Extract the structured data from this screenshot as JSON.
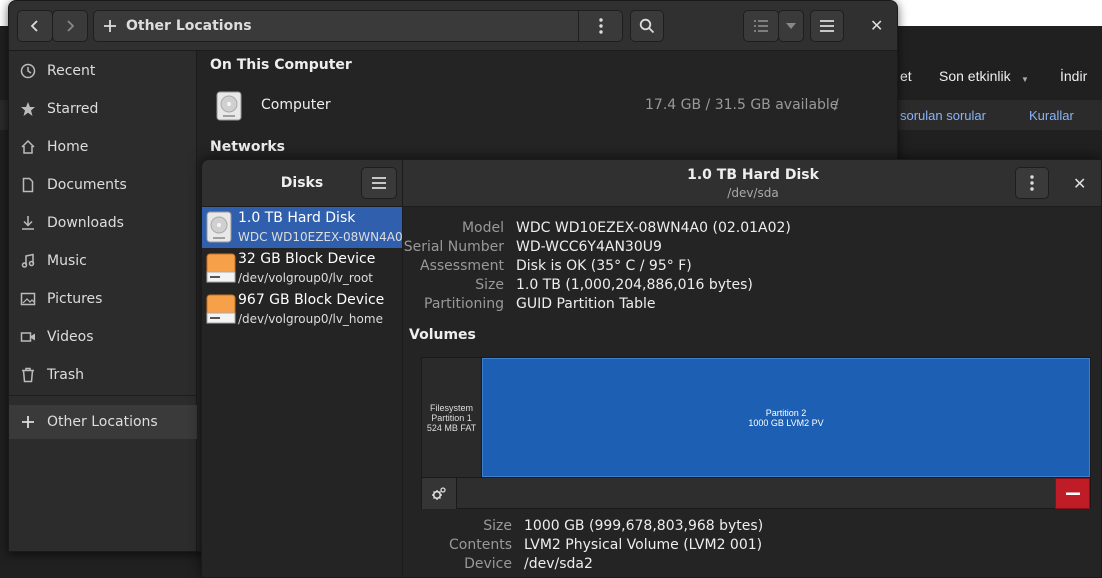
{
  "background_page": {
    "nav": [
      "et",
      "Son etkinlik",
      "İndir"
    ],
    "subnav": [
      "sorulan sorular",
      "Kurallar"
    ]
  },
  "files": {
    "path": "Other Locations",
    "sidebar": [
      {
        "label": "Recent",
        "icon": "clock-icon"
      },
      {
        "label": "Starred",
        "icon": "star-icon"
      },
      {
        "label": "Home",
        "icon": "home-icon"
      },
      {
        "label": "Documents",
        "icon": "document-icon"
      },
      {
        "label": "Downloads",
        "icon": "download-icon"
      },
      {
        "label": "Music",
        "icon": "music-icon"
      },
      {
        "label": "Pictures",
        "icon": "picture-icon"
      },
      {
        "label": "Videos",
        "icon": "video-icon"
      },
      {
        "label": "Trash",
        "icon": "trash-icon"
      },
      {
        "label": "Other Locations",
        "icon": "plus-icon"
      }
    ],
    "on_this_computer": "On This Computer",
    "computer": {
      "name": "Computer",
      "available": "17.4 GB / 31.5 GB available",
      "mount": "/"
    },
    "networks": "Networks"
  },
  "disks": {
    "title": "Disks",
    "drive_title": "1.0 TB Hard Disk",
    "drive_subtitle": "/dev/sda",
    "list": [
      {
        "name": "1.0 TB Hard Disk",
        "sub": "WDC WD10EZEX-08WN4A0",
        "selected": true
      },
      {
        "name": "32 GB Block Device",
        "sub": "/dev/volgroup0/lv_root",
        "selected": false
      },
      {
        "name": "967 GB Block Device",
        "sub": "/dev/volgroup0/lv_home",
        "selected": false
      }
    ],
    "drive_info": [
      {
        "key": "Model",
        "value": "WDC WD10EZEX-08WN4A0 (02.01A02)"
      },
      {
        "key": "Serial Number",
        "value": "WD-WCC6Y4AN30U9"
      },
      {
        "key": "Assessment",
        "value": "Disk is OK (35° C / 95° F)"
      },
      {
        "key": "Size",
        "value": "1.0 TB (1,000,204,886,016 bytes)"
      },
      {
        "key": "Partitioning",
        "value": "GUID Partition Table"
      }
    ],
    "volumes_label": "Volumes",
    "partitions": [
      {
        "line1": "Filesystem",
        "line2": "Partition 1",
        "line3": "524 MB FAT"
      },
      {
        "line1": "Partition 2",
        "line2": "1000 GB LVM2 PV"
      }
    ],
    "partition_info": [
      {
        "key": "Size",
        "value": "1000 GB (999,678,803,968 bytes)"
      },
      {
        "key": "Contents",
        "value": "LVM2 Physical Volume (LVM2 001)"
      },
      {
        "key": "Device",
        "value": "/dev/sda2"
      }
    ]
  }
}
